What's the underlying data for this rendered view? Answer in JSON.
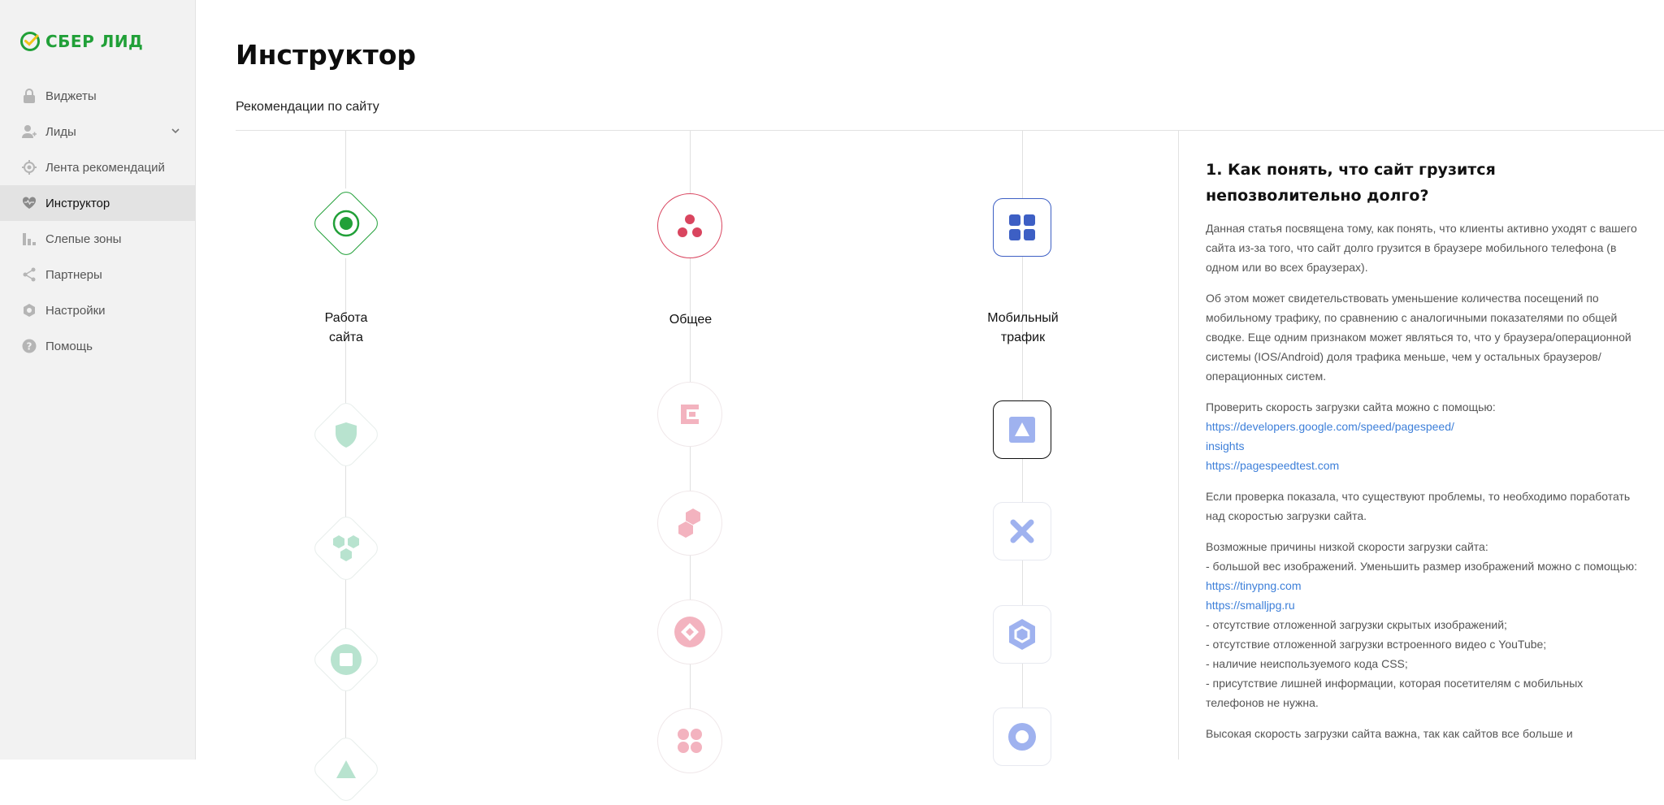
{
  "brand": {
    "name": "СБЕР ЛИД",
    "color": "#21a038"
  },
  "sidebar": {
    "items": [
      {
        "label": "Виджеты",
        "icon": "lock-icon"
      },
      {
        "label": "Лиды",
        "icon": "user-icon",
        "expandable": true
      },
      {
        "label": "Лента рекомендаций",
        "icon": "target-icon"
      },
      {
        "label": "Инструктор",
        "icon": "heart-pulse-icon",
        "active": true
      },
      {
        "label": "Слепые зоны",
        "icon": "bar-chart-icon"
      },
      {
        "label": "Партнеры",
        "icon": "share-icon"
      },
      {
        "label": "Настройки",
        "icon": "gear-icon"
      },
      {
        "label": "Помощь",
        "icon": "question-icon"
      }
    ]
  },
  "page": {
    "title": "Инструктор",
    "subtitle": "Рекомендации по сайту"
  },
  "map": {
    "columns": [
      {
        "label": "Работа\nсайта",
        "accent": "#21a038",
        "muted": "#b8e3cf",
        "nodes": [
          "target-dot-icon",
          "shield-icon",
          "hexagons-icon",
          "square-icon",
          "triangle-icon"
        ]
      },
      {
        "label": "Общее",
        "accent": "#d9455f",
        "muted": "#f3b3bf",
        "nodes": [
          "three-dots-icon",
          "bracket-icon",
          "hexagon-pair-icon",
          "diamond-icon",
          "four-dots-icon"
        ]
      },
      {
        "label": "Мобильный\nтрафик",
        "accent": "#3d5fc4",
        "muted": "#9fb2ef",
        "nodes": [
          "grid-icon",
          "triangle-icon",
          "cross-icon",
          "hexagon-icon",
          "ring-icon"
        ]
      }
    ]
  },
  "article": {
    "heading": "1. Как понять, что сайт грузится непозволительно долго?",
    "p1": "Данная статья посвящена тому, как понять, что клиенты активно уходят с вашего сайта из-за того, что сайт долго грузится в браузере мобильного телефона (в одном или во всех браузерах).",
    "p2": "Об этом может свидетельствовать уменьшение количества посещений по мобильному трафику, по сравнению с аналогичными показателями по общей сводке. Еще одним признаком может являться то, что у браузера/операционной системы (IOS/Android) доля трафика меньше, чем у остальных браузеров/операционных систем.",
    "p3_intro": "Проверить скорость загрузки сайта можно с помощью:",
    "p3_link1a": "https://developers.google.com/speed/pagespeed/",
    "p3_link1b": "insights",
    "p3_link2": "https://pagespeedtest.com",
    "p4": "Если проверка показала, что существуют проблемы, то необходимо поработать над скоростью загрузки сайта.",
    "p5_intro": "Возможные причины низкой скорости загрузки сайта:",
    "p5_item1": "- большой вес изображений. Уменьшить размер изображений можно с помощью:",
    "p5_link1": "https://tinypng.com",
    "p5_link2": "https://smalljpg.ru",
    "p5_item2": "- отсутствие отложенной загрузки скрытых изображений;",
    "p5_item3": "- отсутствие отложенной загрузки встроенного видео с YouTube;",
    "p5_item4": "- наличие неиспользуемого кода CSS;",
    "p5_item5": "- присутствие лишней информации, которая посетителям с мобильных телефонов не нужна.",
    "p6_partial": "Высокая скорость загрузки сайта важна, так как сайтов все больше и"
  },
  "colors": {
    "link": "#3d7fd9",
    "sidebar_bg": "#f2f2f2",
    "active_bg": "#e3e3e3"
  }
}
